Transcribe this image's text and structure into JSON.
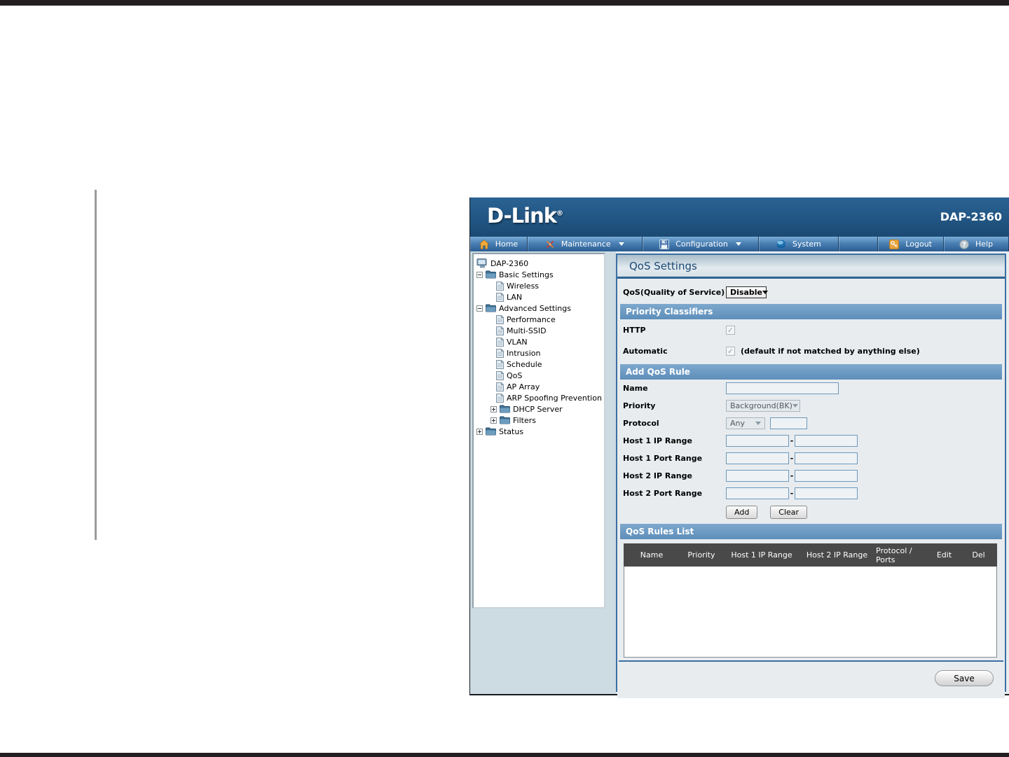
{
  "window": {
    "brand": "D-Link",
    "brand_mark": "®",
    "model": "DAP-2360"
  },
  "menu": {
    "items": [
      {
        "label": "Home",
        "icon": "home-icon"
      },
      {
        "label": "Maintenance",
        "icon": "tools-icon",
        "dropdown": true
      },
      {
        "label": "Configuration",
        "icon": "floppy-icon",
        "dropdown": true
      },
      {
        "label": "System",
        "icon": "globe-icon"
      },
      {
        "label": "Logout",
        "icon": "key-icon"
      },
      {
        "label": "Help",
        "icon": "help-icon"
      }
    ]
  },
  "tree": {
    "items": [
      {
        "label": "DAP-2360",
        "type": "device"
      },
      {
        "label": "Basic Settings",
        "type": "folder",
        "state": "expanded"
      },
      {
        "label": "Wireless",
        "type": "page"
      },
      {
        "label": "LAN",
        "type": "page"
      },
      {
        "label": "Advanced Settings",
        "type": "folder",
        "state": "expanded"
      },
      {
        "label": "Performance",
        "type": "page"
      },
      {
        "label": "Multi-SSID",
        "type": "page"
      },
      {
        "label": "VLAN",
        "type": "page"
      },
      {
        "label": "Intrusion",
        "type": "page"
      },
      {
        "label": "Schedule",
        "type": "page"
      },
      {
        "label": "QoS",
        "type": "page"
      },
      {
        "label": "AP Array",
        "type": "page"
      },
      {
        "label": "ARP Spoofing Prevention",
        "type": "page"
      },
      {
        "label": "DHCP Server",
        "type": "folder",
        "state": "collapsed"
      },
      {
        "label": "Filters",
        "type": "folder",
        "state": "collapsed"
      },
      {
        "label": "Status",
        "type": "folder",
        "state": "collapsed"
      }
    ]
  },
  "main": {
    "title": "QoS Settings",
    "qos": {
      "label": "QoS(Quality of Service)",
      "value": "Disable"
    },
    "priority_classifiers": {
      "title": "Priority Classifiers",
      "http_label": "HTTP",
      "http_checked": true,
      "automatic_label": "Automatic",
      "automatic_checked": true,
      "automatic_note": "(default if not matched by anything else)"
    },
    "add_rule": {
      "title": "Add QoS Rule",
      "name_label": "Name",
      "name_value": "",
      "priority_label": "Priority",
      "priority_value": "Background(BK)",
      "protocol_label": "Protocol",
      "protocol_value": "Any",
      "protocol_port_value": "",
      "host1_ip_label": "Host 1 IP Range",
      "host1_port_label": "Host 1 Port Range",
      "host2_ip_label": "Host 2 IP Range",
      "host2_port_label": "Host 2 Port Range",
      "range_separator": "-",
      "add_button": "Add",
      "clear_button": "Clear"
    },
    "rules_list": {
      "title": "QoS Rules List",
      "columns": [
        "Name",
        "Priority",
        "Host 1 IP Range",
        "Host 2 IP Range",
        "Protocol / Ports",
        "Edit",
        "Del"
      ],
      "rows": []
    },
    "save_button": "Save"
  },
  "colors": {
    "header_blue": "#1c4a75",
    "menubar_blue": "#4a80b4",
    "section_header_blue": "#6f9cc4",
    "panel_border_blue": "#3a70a3",
    "table_header_gray": "#494949",
    "sidebar_bg": "#cddbe3",
    "content_bg": "#e9edf0",
    "accent_orange": "#e8a33d"
  }
}
